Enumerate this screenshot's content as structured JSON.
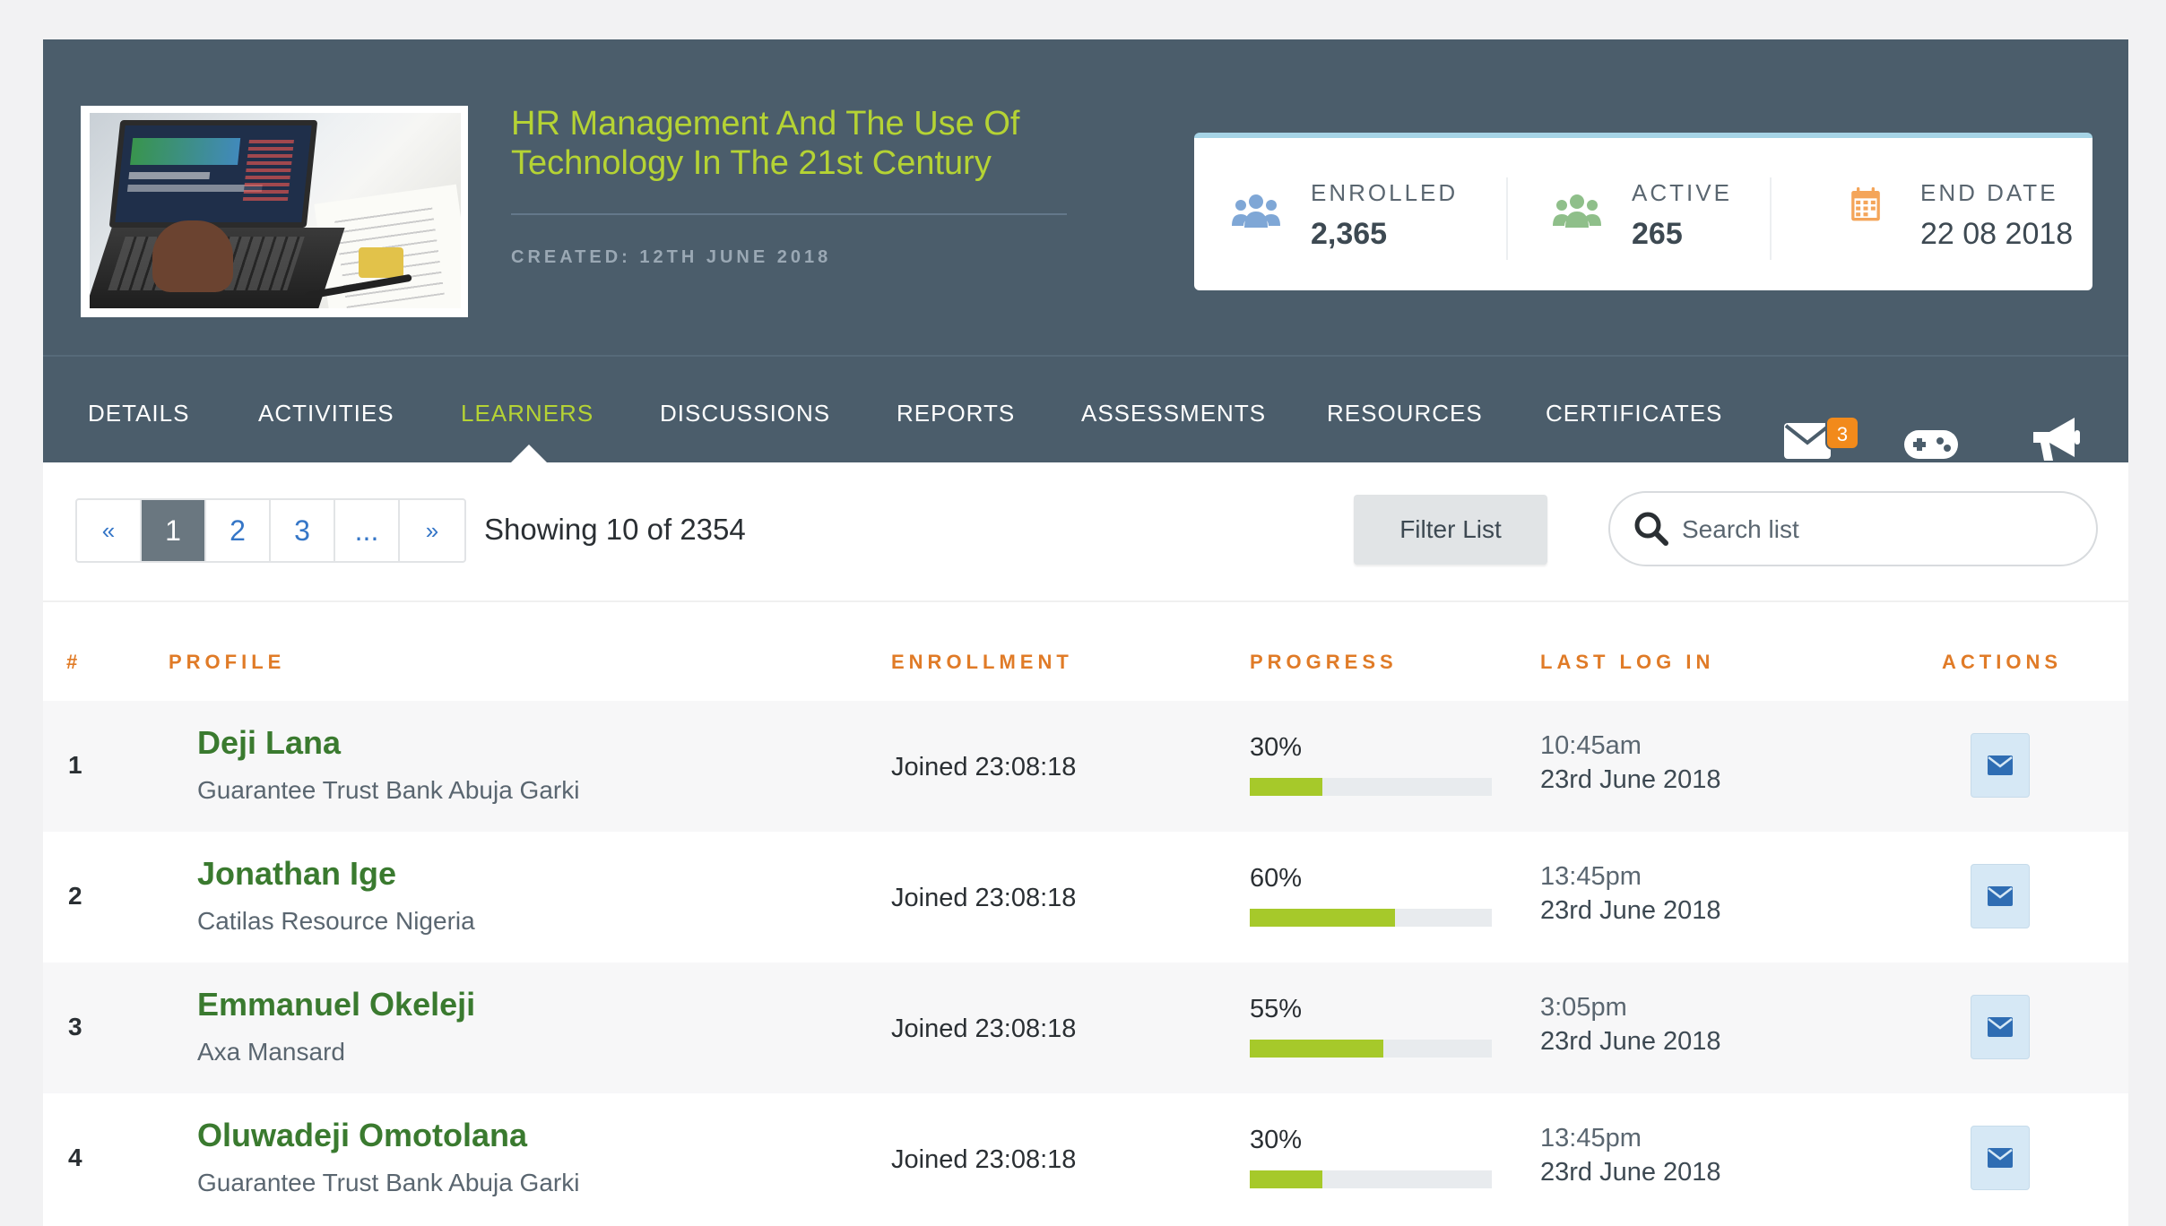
{
  "course": {
    "title": "HR Management And The Use Of Technology In The 21st Century",
    "created": "CREATED: 12TH JUNE 2018"
  },
  "stats": [
    {
      "label": "ENROLLED",
      "value": "2,365",
      "icon": "users-icon",
      "color": "#7fa7d6"
    },
    {
      "label": "ACTIVE",
      "value": "265",
      "icon": "users-icon",
      "color": "#8fbf8a"
    },
    {
      "label": "END DATE",
      "value": "22 08 2018",
      "icon": "calendar-icon",
      "color": "#f4a55a"
    }
  ],
  "nav": {
    "items": [
      {
        "label": "DETAILS",
        "active": false
      },
      {
        "label": "ACTIVITIES",
        "active": false
      },
      {
        "label": "LEARNERS",
        "active": true
      },
      {
        "label": "DISCUSSIONS",
        "active": false
      },
      {
        "label": "REPORTS",
        "active": false
      },
      {
        "label": "ASSESSMENTS",
        "active": false
      },
      {
        "label": "RESOURCES",
        "active": false
      },
      {
        "label": "CERTIFICATES",
        "active": false
      }
    ],
    "icons": [
      "envelope-icon",
      "gamepad-icon",
      "megaphone-icon"
    ],
    "message_badge": "3"
  },
  "toolbar": {
    "pager": {
      "prev": "«",
      "pages": [
        "1",
        "2",
        "3",
        "..."
      ],
      "next": "»",
      "current": "1"
    },
    "showing": "Showing 10 of 2354",
    "filter_label": "Filter List",
    "search_placeholder": "Search list"
  },
  "table": {
    "headers": {
      "num": "#",
      "profile": "PROFILE",
      "enrollment": "ENROLLMENT",
      "progress": "PROGRESS",
      "last_login": "LAST LOG IN",
      "actions": "ACTIONS"
    },
    "rows": [
      {
        "num": "1",
        "name": "Deji Lana",
        "org": "Guarantee Trust Bank Abuja Garki",
        "enrollment": "Joined 23:08:18",
        "progress_label": "30%",
        "progress": 30,
        "time": "10:45am",
        "date": "23rd June 2018"
      },
      {
        "num": "2",
        "name": "Jonathan Ige",
        "org": "Catilas Resource Nigeria",
        "enrollment": "Joined 23:08:18",
        "progress_label": "60%",
        "progress": 60,
        "time": "13:45pm",
        "date": "23rd June 2018"
      },
      {
        "num": "3",
        "name": "Emmanuel Okeleji",
        "org": "Axa Mansard",
        "enrollment": "Joined 23:08:18",
        "progress_label": "55%",
        "progress": 55,
        "time": "3:05pm",
        "date": "23rd June 2018"
      },
      {
        "num": "4",
        "name": "Oluwadeji Omotolana",
        "org": "Guarantee Trust Bank Abuja Garki",
        "enrollment": "Joined 23:08:18",
        "progress_label": "30%",
        "progress": 30,
        "time": "13:45pm",
        "date": "23rd June 2018"
      }
    ]
  },
  "colors": {
    "header_bg": "#4b5d6b",
    "accent_green": "#b5d334",
    "name_green": "#3a7a2f",
    "header_orange": "#e07b27",
    "badge_orange": "#f28a1b",
    "progress_fill": "#a6c92a"
  }
}
